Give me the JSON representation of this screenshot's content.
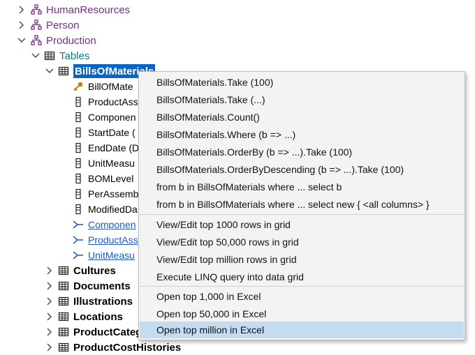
{
  "tree": {
    "schemas": [
      {
        "label": "HumanResources",
        "expanded": false
      },
      {
        "label": "Person",
        "expanded": false
      },
      {
        "label": "Production",
        "expanded": true
      }
    ],
    "tables_folder": "Tables",
    "selected_table": "BillsOfMaterials",
    "columns": [
      "BillOfMate",
      "ProductAss",
      "Componen",
      "StartDate (",
      "EndDate (D",
      "UnitMeasu",
      "BOMLevel",
      "PerAssemb",
      "ModifiedDa"
    ],
    "relations": [
      "Componen",
      "ProductAss",
      "UnitMeasu"
    ],
    "other_tables": [
      "Cultures",
      "Documents",
      "Illustrations",
      "Locations",
      "ProductCateg",
      "ProductCostHistories"
    ]
  },
  "context_menu": {
    "items": [
      "BillsOfMaterials.Take (100)",
      "BillsOfMaterials.Take (...)",
      "BillsOfMaterials.Count()",
      "BillsOfMaterials.Where (b => ...)",
      "BillsOfMaterials.OrderBy (b => ...).Take (100)",
      "BillsOfMaterials.OrderByDescending (b => ...).Take (100)",
      "from b in BillsOfMaterials where ...  select b",
      "from b in BillsOfMaterials where ...  select new { <all columns> }",
      "View/Edit top 1000 rows in grid",
      "View/Edit top 50,000 rows in grid",
      "View/Edit top million rows in grid",
      "Execute LINQ query into data grid",
      "Open top 1,000 in Excel",
      "Open top 50,000 in Excel",
      "Open top million in Excel"
    ],
    "highlighted_item": "Open top million in Excel"
  },
  "colors": {
    "schema": "#7a2a8c",
    "folder": "#0f7a80",
    "selection": "#0a64c8",
    "link": "#1f56d0",
    "menu_hover": "#c5dcf0"
  }
}
